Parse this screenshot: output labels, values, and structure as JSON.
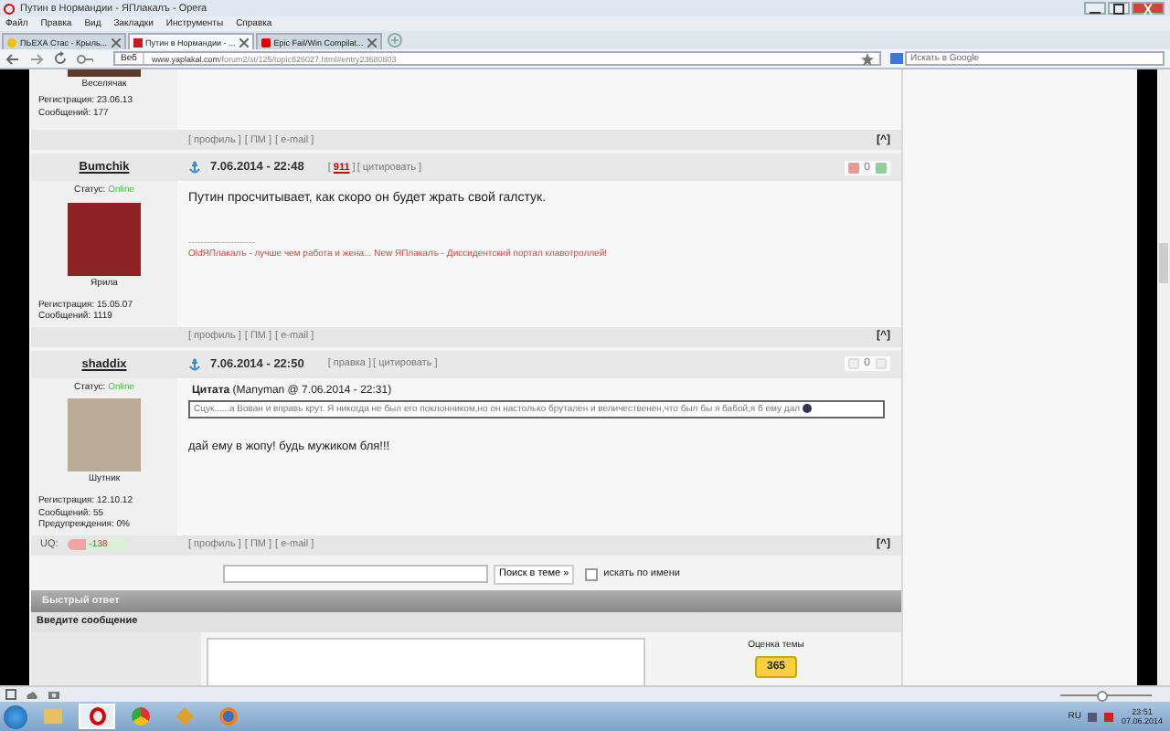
{
  "window": {
    "title": "Путин в Нормандии - ЯПлакалъ - Opera"
  },
  "menu": [
    "Файл",
    "Правка",
    "Вид",
    "Закладки",
    "Инструменты",
    "Справка"
  ],
  "tabs": [
    {
      "label": "ПЬЕХА Стас - Крыль...",
      "selected": false,
      "kind": "dot"
    },
    {
      "label": "Путин в Нормандии - ...",
      "selected": true,
      "kind": "site"
    },
    {
      "label": "Epic Fail/Win Compilat...",
      "selected": false,
      "kind": "video"
    }
  ],
  "address_bar": {
    "security_label": "Веб",
    "url_host": "www.yaplakal.com",
    "url_path": "/forum2/st/125/topic826027.html#entry23680803",
    "search_placeholder": "Искать в Google"
  },
  "top_fragment": {
    "rank": "Веселячак",
    "registration": "Регистрация: 23.06.13",
    "messages": "Сообщений: 177",
    "links": [
      "[ профиль ]",
      "[ ПМ ]",
      "[ e-mail ]"
    ],
    "top_link": "[^]"
  },
  "posts": [
    {
      "author": "Bumchik",
      "status_label": "Статус:",
      "status": "Online",
      "rank": "Ярила",
      "registration": "Регистрация: 15.05.07",
      "messages": "Сообщений: 1119",
      "date": "7.06.2014 - 22:48",
      "actions": [
        {
          "label": "[ **911** ]",
          "kind": "karma"
        },
        {
          "label": "[ цитировать ]",
          "kind": "link"
        }
      ],
      "votes": "0",
      "voting_enabled": true,
      "text": "Путин просчитывает, как скоро он будет жрать свой галстук.",
      "signature": {
        "divider": "----------------------",
        "old": "OldЯПлакалъ - лучше чем работа и жена...",
        "new": "New ЯПлакалъ - Диссидентский портал клавотроллей!"
      },
      "links": [
        "[ профиль ]",
        "[ ПМ ]",
        "[ e-mail ]"
      ],
      "top_link": "[^]"
    },
    {
      "author": "shaddix",
      "status_label": "Статус:",
      "status": "Online",
      "rank": "Шутник",
      "registration": "Регистрация: 12.10.12",
      "messages": "Сообщений: 55",
      "warnings": "Предупреждения: 0%",
      "date": "7.06.2014 - 22:50",
      "actions": [
        {
          "label": "[ правка ]",
          "kind": "link"
        },
        {
          "label": "[ цитировать ]",
          "kind": "link"
        }
      ],
      "votes": "0",
      "voting_enabled": false,
      "quote": {
        "header": "**Цитата** (Manyman @ 7.06.2014 - 22:31)",
        "text": "Сцук......а Вован и вправь крут. Я никогда не был его поклонником,но он настолько брутален и величественен,что был бы я бабой,я б ему дал"
      },
      "text": "дай ему в жопу! будь мужиком бля!!!",
      "uq": {
        "label": "UQ:",
        "value": "-138",
        "level": 0.3
      },
      "links": [
        "[ профиль ]",
        "[ ПМ ]",
        "[ e-mail ]"
      ],
      "top_link": "[^]"
    }
  ],
  "search": {
    "button": "Поиск в теме »",
    "checkbox_label": "искать по имени",
    "checked": false
  },
  "quick_reply": {
    "title": "Быстрый ответ",
    "prompt": "Введите сообщение",
    "rating_label": "Оценка темы",
    "rating": "365"
  },
  "status_bar": {
    "zoom": {
      "level": 0.45
    }
  },
  "taskbar": {
    "language": "RU",
    "time": "23:51",
    "date": "07.06.2014"
  }
}
